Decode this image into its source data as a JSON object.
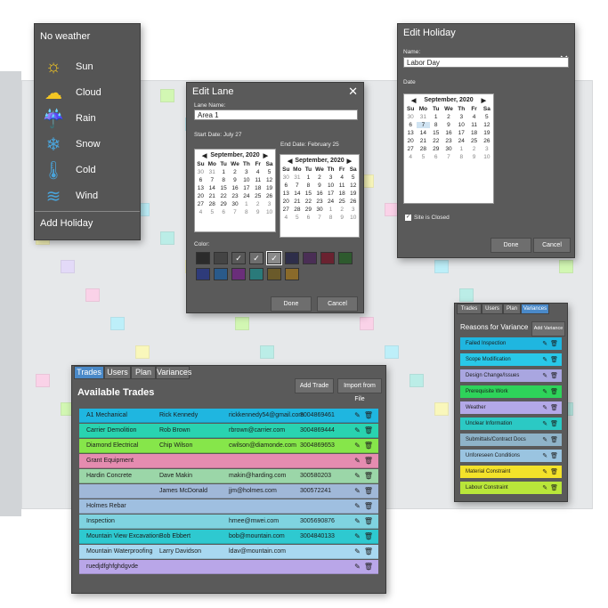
{
  "weather_menu": {
    "title": "No weather",
    "items": [
      {
        "label": "Sun",
        "icon": "sun-icon",
        "glyph": "☼",
        "color": "#f3c623"
      },
      {
        "label": "Cloud",
        "icon": "cloud-icon",
        "glyph": "☁",
        "color": "#f3c623"
      },
      {
        "label": "Rain",
        "icon": "rain-icon",
        "glyph": "☔",
        "color": "#4aa3d9"
      },
      {
        "label": "Snow",
        "icon": "snow-icon",
        "glyph": "❄",
        "color": "#4aa3d9"
      },
      {
        "label": "Cold",
        "icon": "thermometer-icon",
        "glyph": "🌡",
        "color": "#4aa3d9"
      },
      {
        "label": "Wind",
        "icon": "wind-icon",
        "glyph": "≋",
        "color": "#4aa3d9"
      }
    ],
    "add_holiday": "Add Holiday"
  },
  "edit_lane": {
    "title": "Edit Lane",
    "close": "✕",
    "lane_name_label": "Lane Name:",
    "lane_name_value": "Area 1",
    "start_label": "Start Date: July 27",
    "end_label": "End Date: February 25",
    "cal_left": {
      "month": "September, 2020",
      "days_header": [
        "Su",
        "Mo",
        "Tu",
        "We",
        "Th",
        "Fr",
        "Sa"
      ],
      "days": [
        "30",
        "31",
        "1",
        "2",
        "3",
        "4",
        "5",
        "6",
        "7",
        "8",
        "9",
        "10",
        "11",
        "12",
        "13",
        "14",
        "15",
        "16",
        "17",
        "18",
        "19",
        "20",
        "21",
        "22",
        "23",
        "24",
        "25",
        "26",
        "27",
        "28",
        "29",
        "30",
        "1",
        "2",
        "3",
        "4",
        "5",
        "6",
        "7",
        "8",
        "9",
        "10"
      ]
    },
    "cal_right": {
      "month": "September, 2020",
      "days_header": [
        "Su",
        "Mo",
        "Tu",
        "We",
        "Th",
        "Fr",
        "Sa"
      ],
      "days": [
        "30",
        "31",
        "1",
        "2",
        "3",
        "4",
        "5",
        "6",
        "7",
        "8",
        "9",
        "10",
        "11",
        "12",
        "13",
        "14",
        "15",
        "16",
        "17",
        "18",
        "19",
        "20",
        "21",
        "22",
        "23",
        "24",
        "25",
        "26",
        "27",
        "28",
        "29",
        "30",
        "1",
        "2",
        "3",
        "4",
        "5",
        "6",
        "7",
        "8",
        "9",
        "10"
      ]
    },
    "color_label": "Color:",
    "swatches_row1": [
      "#2b2b2b",
      "#444444",
      "#585858",
      "#6e6e6e",
      "#8a8a8a",
      "#2e2e4a",
      "#4a2e55",
      "#6a2230",
      "#2e5a2e"
    ],
    "swatches_row2": [
      "#2e3b7a",
      "#2a5a8a",
      "#6a2e7a",
      "#2a7a7a",
      "#6a5a2a",
      "#8a6a2a"
    ],
    "done": "Done",
    "cancel": "Cancel"
  },
  "edit_holiday": {
    "title": "Edit Holiday",
    "close": "✕",
    "name_label": "Name:",
    "name_value": "Labor Day",
    "date_label": "Date",
    "month": "September, 2020",
    "days_header": [
      "Su",
      "Mo",
      "Tu",
      "We",
      "Th",
      "Fr",
      "Sa"
    ],
    "days": [
      "30",
      "31",
      "1",
      "2",
      "3",
      "4",
      "5",
      "6",
      "7",
      "8",
      "9",
      "10",
      "11",
      "12",
      "13",
      "14",
      "15",
      "16",
      "17",
      "18",
      "19",
      "20",
      "21",
      "22",
      "23",
      "24",
      "25",
      "26",
      "27",
      "28",
      "29",
      "30",
      "1",
      "2",
      "3",
      "4",
      "5",
      "6",
      "7",
      "8",
      "9",
      "10"
    ],
    "site_closed": "Site is Closed",
    "done": "Done",
    "cancel": "Cancel"
  },
  "trades_panel": {
    "tabs": [
      "Trades",
      "Users",
      "Plan",
      "Variances"
    ],
    "title": "Available Trades",
    "add_trade": "Add Trade",
    "import_file": "Import from File",
    "rows": [
      {
        "name": "A1 Mechanical",
        "contact": "Rick Kennedy",
        "email": "rickkennedy54@gmail.com",
        "phone": "3004869461",
        "color": "#1fb6e0"
      },
      {
        "name": "Carrier Demolition",
        "contact": "Rob Brown",
        "email": "rbrown@carrier.com",
        "phone": "3004869444",
        "color": "#29d3b0"
      },
      {
        "name": "Diamond Electrical",
        "contact": "Chip Wilson",
        "email": "cwilson@diamonde.com",
        "phone": "3004869653",
        "color": "#86e64a"
      },
      {
        "name": "Grant Equipment",
        "contact": "",
        "email": "",
        "phone": "",
        "color": "#e58cb0"
      },
      {
        "name": "Hardin Concrete",
        "contact": "Dave Makin",
        "email": "makin@harding.com",
        "phone": "300580203",
        "color": "#9bd6a8"
      },
      {
        "name": "",
        "contact": "James McDonald",
        "email": "jjm@holmes.com",
        "phone": "300572241",
        "color": "#a0b8d8"
      },
      {
        "name": "Holmes Rebar",
        "contact": "",
        "email": "",
        "phone": "",
        "color": "#9fbfe0"
      },
      {
        "name": "Inspection",
        "contact": "",
        "email": "hmee@mwei.com",
        "phone": "3005690876",
        "color": "#7fd3e0"
      },
      {
        "name": "Mountain View Excavation",
        "contact": "Bob Ebbert",
        "email": "bob@mountain.com",
        "phone": "3004840133",
        "color": "#2ec9d0"
      },
      {
        "name": "Mountain Waterproofing",
        "contact": "Larry Davidson",
        "email": "ldav@mountain.com",
        "phone": "",
        "color": "#a8d8f0"
      },
      {
        "name": "ruedjdfghfghdgvde",
        "contact": "",
        "email": "",
        "phone": "",
        "color": "#b9a6e8"
      }
    ]
  },
  "variance_panel": {
    "tabs": [
      "Trades",
      "Users",
      "Plan",
      "Variances"
    ],
    "title": "Reasons for Variance",
    "add_variance": "Add Variance",
    "rows": [
      {
        "label": "Failed Inspection",
        "color": "#1fb6e0"
      },
      {
        "label": "Scope Modification",
        "color": "#29c8e8"
      },
      {
        "label": "Design Change/Issues",
        "color": "#a9a6e0"
      },
      {
        "label": "Prerequisite Work",
        "color": "#2ed35a"
      },
      {
        "label": "Weather",
        "color": "#b3a8e8"
      },
      {
        "label": "Unclear Information",
        "color": "#2bc9c4"
      },
      {
        "label": "Submittals/Contract Docs",
        "color": "#8fb3c8"
      },
      {
        "label": "Unforeseen Conditions",
        "color": "#9ac4e0"
      },
      {
        "label": "Material Constraint",
        "color": "#f3e22a"
      },
      {
        "label": "Labour Constraint",
        "color": "#b9e63a"
      }
    ]
  }
}
